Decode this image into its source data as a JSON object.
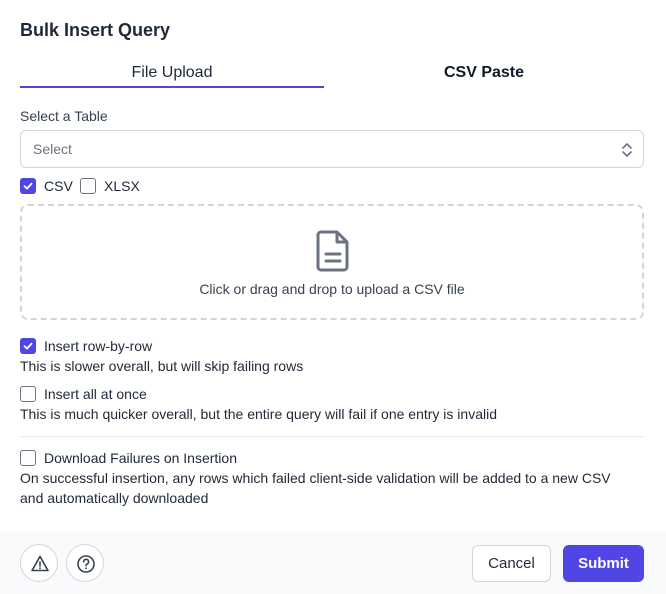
{
  "dialog": {
    "title": "Bulk Insert Query"
  },
  "tabs": [
    {
      "label": "File Upload",
      "active": true
    },
    {
      "label": "CSV Paste",
      "active": false
    }
  ],
  "table_select": {
    "label": "Select a Table",
    "placeholder": "Select"
  },
  "format": {
    "csv": {
      "label": "CSV",
      "checked": true
    },
    "xlsx": {
      "label": "XLSX",
      "checked": false
    }
  },
  "dropzone": {
    "text": "Click or drag and drop to upload a CSV file",
    "icon": "file-icon"
  },
  "options": {
    "row_by_row": {
      "label": "Insert row-by-row",
      "checked": true,
      "description": "This is slower overall, but will skip failing rows"
    },
    "all_at_once": {
      "label": "Insert all at once",
      "checked": false,
      "description": "This is much quicker overall, but the entire query will fail if one entry is invalid"
    },
    "download_failures": {
      "label": "Download Failures on Insertion",
      "checked": false,
      "description_line1": "On successful insertion, any rows which failed client-side validation will be added to a new CSV",
      "description_line2": "and automatically downloaded"
    }
  },
  "footer": {
    "warning_icon": "warning-icon",
    "help_icon": "help-icon",
    "cancel_label": "Cancel",
    "submit_label": "Submit"
  },
  "colors": {
    "accent": "#5046e5",
    "border": "#d1d5db",
    "footer_bg": "#f9fafb"
  }
}
